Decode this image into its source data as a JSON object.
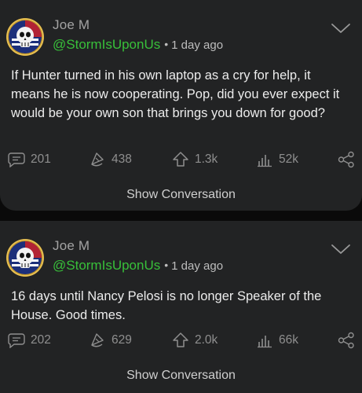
{
  "posts": [
    {
      "author_name": "Joe M",
      "handle": "@StormIsUponUs",
      "separator": "•",
      "age": "1 day ago",
      "text": "If Hunter turned in his own laptop as a cry for help, it means he is now cooperating. Pop, did you ever expect it would be your own son that brings you down for good?",
      "replies": "201",
      "reposts": "438",
      "upvotes": "1.3k",
      "impressions": "52k",
      "show_conversation": "Show Conversation"
    },
    {
      "author_name": "Joe M",
      "handle": "@StormIsUponUs",
      "separator": "•",
      "age": "1 day ago",
      "text": "16 days until Nancy Pelosi is no longer Speaker of the House. Good times.",
      "replies": "202",
      "reposts": "629",
      "upvotes": "2.0k",
      "impressions": "66k",
      "show_conversation": "Show Conversation"
    }
  ],
  "icons": {
    "avatar": "skull-flag-badge-avatar",
    "menu": "chevron-down-icon",
    "reply": "speech-bubble-icon",
    "repost": "echo-icon",
    "upvote": "arrow-up-icon",
    "impressions": "bar-chart-icon",
    "share": "share-icon"
  },
  "colors": {
    "background": "#0a0a0a",
    "card": "#222324",
    "handle": "#38c03a",
    "body_text": "#ececec",
    "muted": "#8f8f8f"
  }
}
